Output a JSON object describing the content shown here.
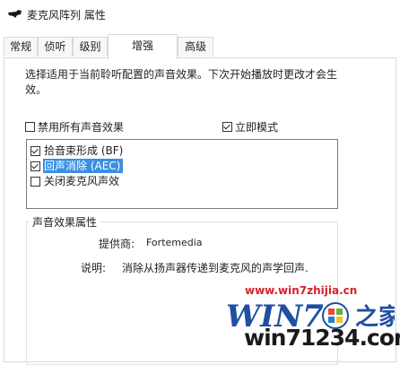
{
  "window": {
    "title": "麦克风阵列 属性"
  },
  "tabs": [
    {
      "label": "常规",
      "active": false
    },
    {
      "label": "侦听",
      "active": false
    },
    {
      "label": "级别",
      "active": false
    },
    {
      "label": "增强",
      "active": true
    },
    {
      "label": "高级",
      "active": false
    }
  ],
  "enhancements": {
    "description": "选择适用于当前聆听配置的声音效果。下次开始播放时更改才会生效。",
    "disable_all": {
      "label": "禁用所有声音效果",
      "checked": false
    },
    "immediate_mode": {
      "label": "立即模式",
      "checked": true
    },
    "effects": [
      {
        "label": "拾音束形成 (BF)",
        "checked": true,
        "selected": false
      },
      {
        "label": "回声消除 (AEC)",
        "checked": true,
        "selected": true
      },
      {
        "label": "关闭麦克风声效",
        "checked": false,
        "selected": false
      }
    ],
    "properties": {
      "title": "声音效果属性",
      "provider_label": "提供商:",
      "provider_value": "Fortemedia",
      "description_label": "说明:",
      "description_value": "消除从扬声器传递到麦克风的声学回声."
    }
  },
  "watermark": {
    "site_text": "www.win7zhijia.cn",
    "logo_text": "WIN7之家",
    "bottom_text": "win71234.com"
  },
  "colors": {
    "selection": "#3b8fe0",
    "watermark_red": "#d4222a",
    "border": "#d9d9d9"
  }
}
